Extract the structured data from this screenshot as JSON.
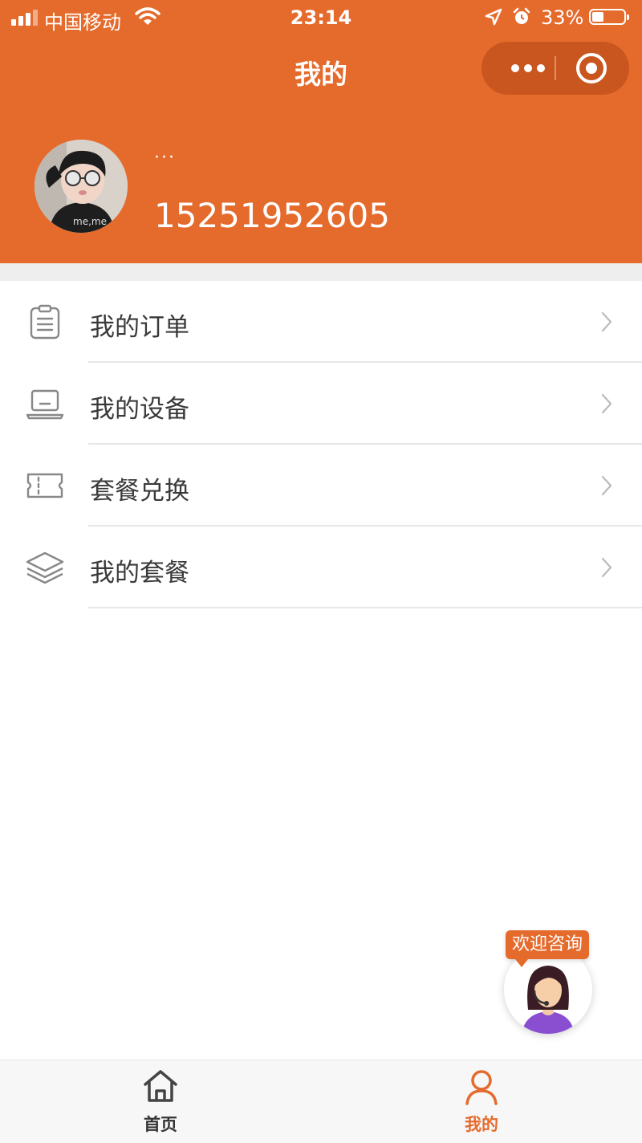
{
  "status_bar": {
    "carrier": "中国移动",
    "time": "23:14",
    "battery_percent": "33%",
    "battery_level": 0.33
  },
  "nav": {
    "title": "我的"
  },
  "profile": {
    "nickname": "···",
    "phone": "15251952605"
  },
  "menu": [
    {
      "label": "我的订单",
      "icon": "clipboard-icon"
    },
    {
      "label": "我的设备",
      "icon": "laptop-icon"
    },
    {
      "label": "套餐兑换",
      "icon": "ticket-icon"
    },
    {
      "label": "我的套餐",
      "icon": "layers-icon"
    }
  ],
  "consult": {
    "label": "欢迎咨询",
    "icon": "customer-service-avatar-icon"
  },
  "tabbar": {
    "items": [
      {
        "label": "首页",
        "icon": "home-icon",
        "active": false
      },
      {
        "label": "我的",
        "icon": "user-icon",
        "active": true
      }
    ]
  },
  "colors": {
    "brand": "#e56b2d",
    "capsule": "#c9561f",
    "divider": "#e7e7e7",
    "section_gap": "#eeeeee"
  }
}
